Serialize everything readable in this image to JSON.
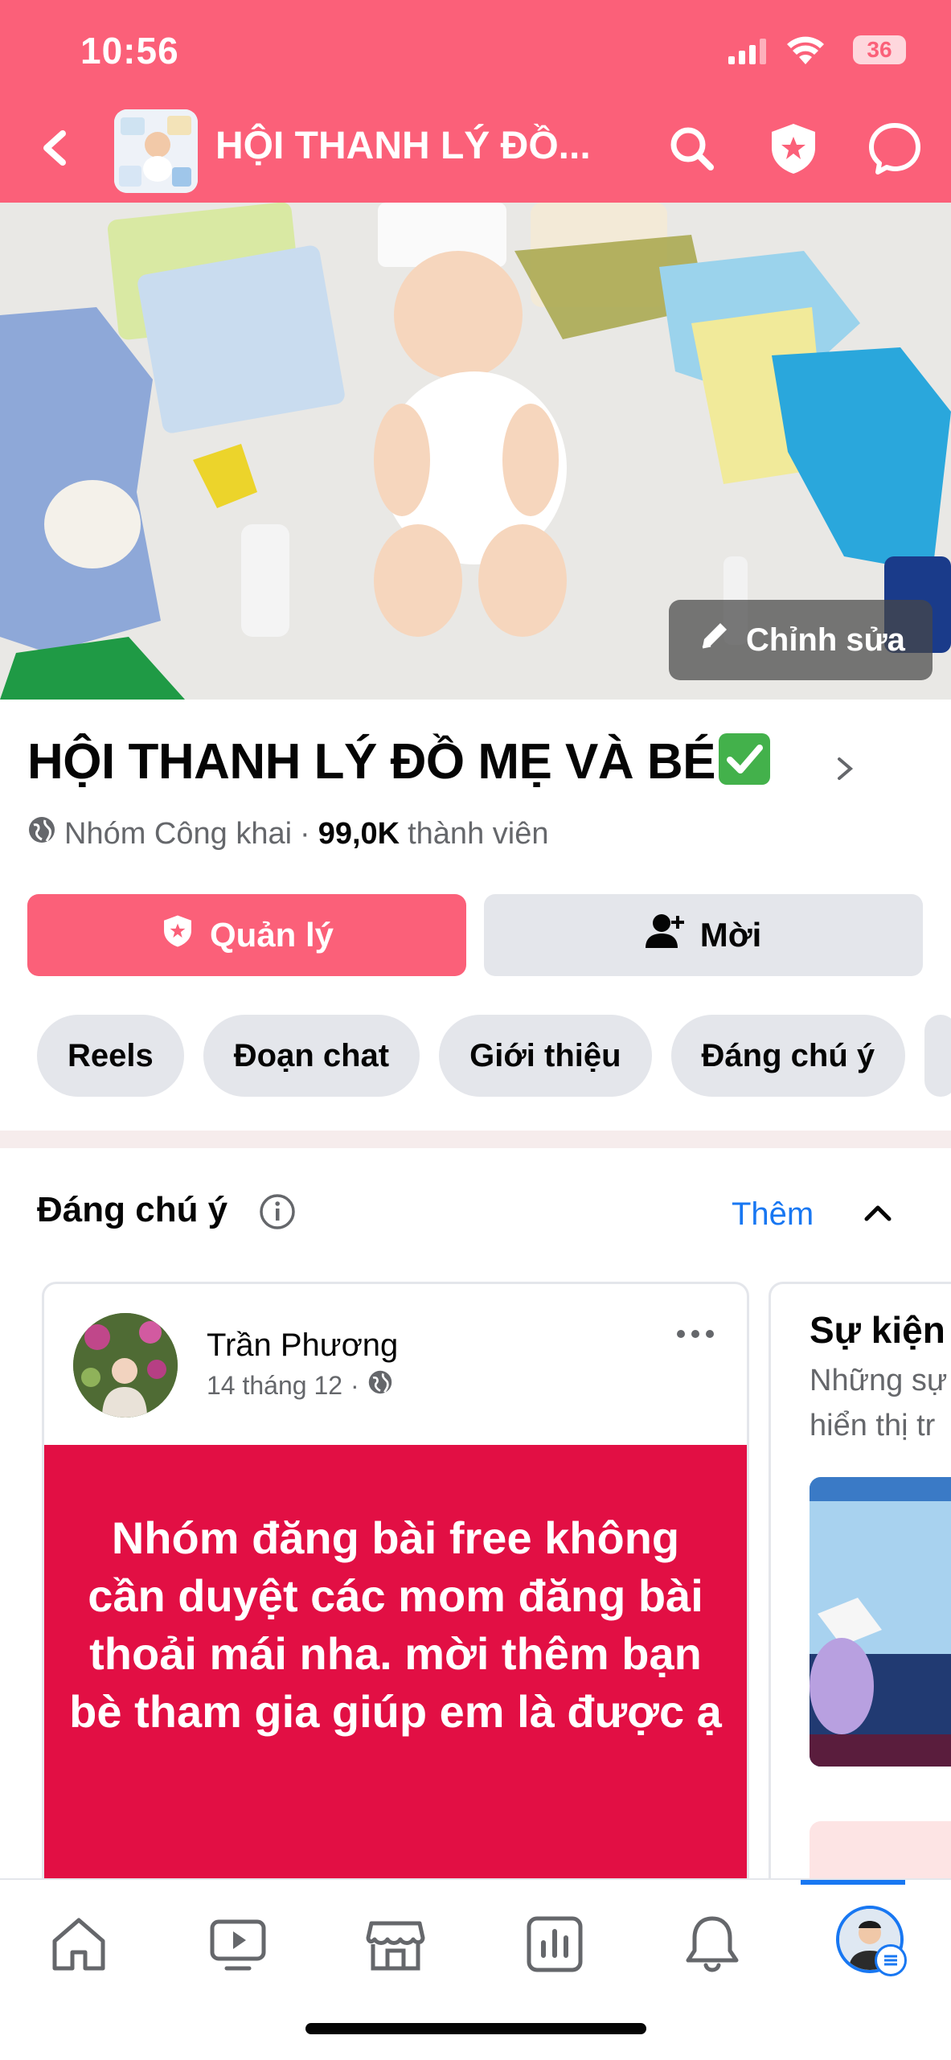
{
  "status_bar": {
    "time": "10:56",
    "battery": "36"
  },
  "header": {
    "title": "HỘI THANH LÝ ĐỒ..."
  },
  "cover": {
    "edit_label": "Chỉnh sửa"
  },
  "group": {
    "name": "HỘI THANH LÝ ĐỒ MẸ VÀ BÉ",
    "privacy": "Nhóm Công khai",
    "member_count": "99,0K",
    "member_label": "thành viên"
  },
  "actions": {
    "manage_label": "Quản lý",
    "invite_label": "Mời"
  },
  "tabs": [
    {
      "label": "Reels"
    },
    {
      "label": "Đoạn chat"
    },
    {
      "label": "Giới thiệu"
    },
    {
      "label": "Đáng chú ý"
    }
  ],
  "featured": {
    "title": "Đáng chú ý",
    "more_label": "Thêm",
    "post": {
      "author": "Trần Phương",
      "date": "14 tháng 12",
      "body": "Nhóm đăng bài free không cần duyệt các mom đăng bài thoải mái nha. mời thêm bạn bè tham gia giúp em là được ạ"
    },
    "event_card": {
      "title": "Sự kiện",
      "desc_line1": "Những sự",
      "desc_line2": "hiển thị tr"
    }
  },
  "colors": {
    "brand_pink": "#fb6079",
    "post_red": "#e20f44",
    "link_blue": "#1877f2"
  },
  "icons": [
    "back-icon",
    "search-icon",
    "admin-shield-icon",
    "messenger-icon",
    "pencil-icon",
    "globe-icon",
    "add-person-icon",
    "info-icon",
    "chevron-up-icon",
    "more-icon",
    "home-icon",
    "video-icon",
    "marketplace-icon",
    "dashboard-icon",
    "bell-icon"
  ]
}
